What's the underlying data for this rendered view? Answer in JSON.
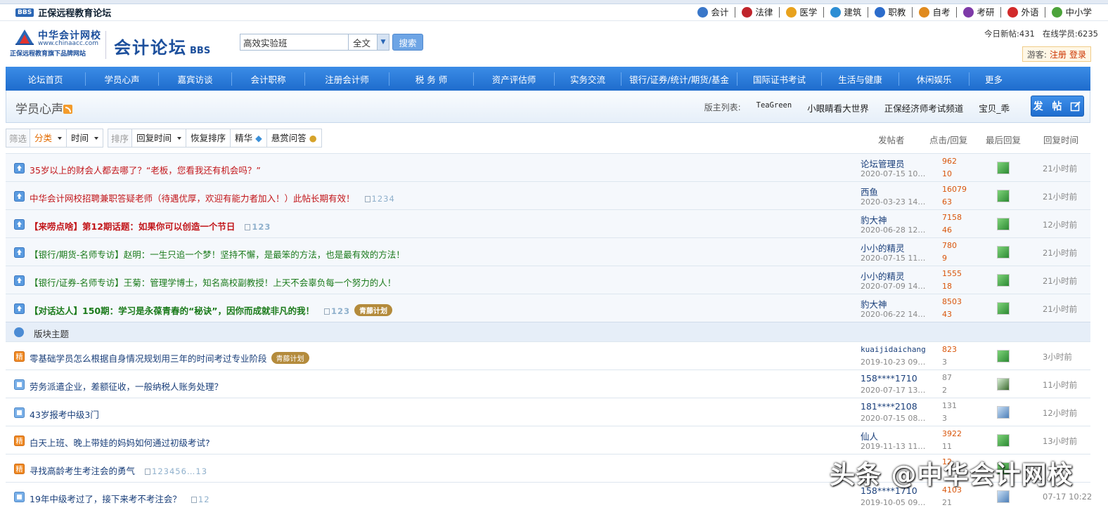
{
  "topbar": {
    "badge": "BBS",
    "brand": "正保远程教育论坛",
    "sites": [
      {
        "label": "会计",
        "color": "#3a77c9",
        "icon": "accounting-icon"
      },
      {
        "label": "法律",
        "color": "#c0242b",
        "icon": "law-icon"
      },
      {
        "label": "医学",
        "color": "#e8a21d",
        "icon": "medicine-icon"
      },
      {
        "label": "建筑",
        "color": "#2d8ed4",
        "icon": "construction-icon"
      },
      {
        "label": "职教",
        "color": "#2c6ccb",
        "icon": "vocational-icon"
      },
      {
        "label": "自考",
        "color": "#e08a1e",
        "icon": "self-exam-icon"
      },
      {
        "label": "考研",
        "color": "#7e3aa8",
        "icon": "postgraduate-icon"
      },
      {
        "label": "外语",
        "color": "#d22a2a",
        "icon": "foreign-language-icon"
      },
      {
        "label": "中小学",
        "color": "#4ca33a",
        "icon": "k12-icon"
      }
    ]
  },
  "header": {
    "logo_name": "中华会计网校",
    "logo_url": "www.chinaacc.com",
    "logo_sub": "正保远程教育旗下品牌网站",
    "forum_title": "会计论坛",
    "forum_suffix": "BBS",
    "search_value": "高效实验班",
    "search_scope": "全文",
    "search_button": "搜索",
    "stats_today_label": "今日新帖:",
    "stats_today": "431",
    "stats_online_label": "在线学员:",
    "stats_online": "6235",
    "guest_label": "游客:",
    "register": "注册",
    "login": "登录"
  },
  "nav": [
    "论坛首页",
    "学员心声",
    "嘉宾访谈",
    "会计职称",
    "注册会计师",
    "税 务 师",
    "资产评估师",
    "实务交流",
    "银行/证券/统计/期货/基金",
    "国际证书考试",
    "生活与健康",
    "休闲娱乐",
    "更多"
  ],
  "section": {
    "title": "学员心声",
    "mods_label": "版主列表:",
    "mods": [
      "TeaGreen",
      "小眼睛看大世界",
      "正保经济师考试频道",
      "宝贝_乖"
    ],
    "post_button": "发 帖"
  },
  "filter": {
    "filter_label": "筛选",
    "category": "分类",
    "time": "时间",
    "sort_label": "排序",
    "reply_time": "回复时间",
    "restore_sort": "恢复排序",
    "digest": "精华",
    "bounty": "悬赏问答"
  },
  "columns": {
    "author": "发帖者",
    "clicks": "点击/回复",
    "last_reply": "最后回复",
    "reply_time": "回复时间"
  },
  "sticky_threads": [
    {
      "title": "35岁以上的财会人都去哪了？“老板，您看我还有机会吗？”",
      "style": "red",
      "pages": "",
      "tag": "",
      "author": "论坛管理员",
      "date": "2020-07-15 10…",
      "clicks": "962",
      "replies": "10",
      "time": "21小时前"
    },
    {
      "title": "中华会计网校招聘兼职答疑老师（待遇优厚，欢迎有能力者加入！）此帖长期有效！",
      "style": "red",
      "pages": "1234",
      "tag": "",
      "author": "西鱼",
      "date": "2020-03-23 14…",
      "clicks": "16079",
      "replies": "63",
      "time": "21小时前"
    },
    {
      "title": "【来唠点啥】第12期话题：如果你可以创造一个节日",
      "style": "red bold",
      "pages": "123",
      "tag": "",
      "author": "豹大神",
      "date": "2020-06-28 12…",
      "clicks": "7158",
      "replies": "46",
      "time": "12小时前"
    },
    {
      "title": "【银行/期货-名师专访】赵明：一生只追一个梦！坚持不懈，是最笨的方法，也是最有效的方法！",
      "style": "green",
      "pages": "",
      "tag": "",
      "author": "小小的精灵",
      "date": "2020-07-15 11…",
      "clicks": "780",
      "replies": "9",
      "time": "21小时前"
    },
    {
      "title": "【银行/证券-名师专访】王菊：管理学博士，知名高校副教授！上天不会辜负每一个努力的人！",
      "style": "green",
      "pages": "",
      "tag": "",
      "author": "小小的精灵",
      "date": "2020-07-09 14…",
      "clicks": "1555",
      "replies": "18",
      "time": "21小时前"
    },
    {
      "title": "【对话达人】150期：学习是永葆青春的“秘诀”，因你而成就非凡的我！",
      "style": "green bold",
      "pages": "123",
      "tag": "青藤计划",
      "author": "豹大神",
      "date": "2020-06-22 14…",
      "clicks": "8503",
      "replies": "43",
      "time": "21小时前"
    }
  ],
  "board_section": "版块主题",
  "threads": [
    {
      "title": "零基础学员怎么根据自身情况规划用三年的时间考过专业阶段",
      "icon": "digest",
      "pages": "",
      "tag": "青藤计划",
      "author": "kuaijidaichang",
      "mono": true,
      "date": "2019-10-23 09…",
      "clicks": "823",
      "replies": "3",
      "hot": true,
      "avatar": "g",
      "time": "3小时前"
    },
    {
      "title": "劳务派遣企业，差额征收，一般纳税人账务处理？",
      "icon": "normal",
      "pages": "",
      "tag": "",
      "author": "158****1710",
      "mono": false,
      "date": "2020-07-17 13…",
      "clicks": "87",
      "replies": "2",
      "hot": false,
      "avatar": "dk",
      "time": "11小时前"
    },
    {
      "title": "43岁报考中级3门",
      "icon": "normal",
      "pages": "",
      "tag": "",
      "author": "181****2108",
      "mono": false,
      "date": "2020-07-15 08…",
      "clicks": "131",
      "replies": "3",
      "hot": false,
      "avatar": "bl",
      "time": "12小时前"
    },
    {
      "title": "白天上班、晚上带娃的妈妈如何通过初级考试?",
      "icon": "digest",
      "pages": "",
      "tag": "",
      "author": "仙人",
      "mono": false,
      "date": "2019-11-13 11…",
      "clicks": "3922",
      "replies": "11",
      "hot": true,
      "avatar": "g",
      "time": "13小时前"
    },
    {
      "title": "寻找高龄考生考注会的勇气",
      "icon": "digest",
      "pages": "123456…13",
      "tag": "",
      "author": "",
      "mono": false,
      "date": "",
      "clicks": "12",
      "replies": "",
      "hot": true,
      "avatar": "g",
      "time": ""
    },
    {
      "title": "19年中级考过了，接下来考不考注会？",
      "icon": "normal",
      "pages": "12",
      "tag": "",
      "author": "158****1710",
      "mono": false,
      "date": "2019-10-05 09…",
      "clicks": "4103",
      "replies": "21",
      "hot": true,
      "avatar": "bl",
      "time": "07-17 10:22"
    }
  ],
  "watermark": "头条 @中华会计网校",
  "digest_label": "精"
}
